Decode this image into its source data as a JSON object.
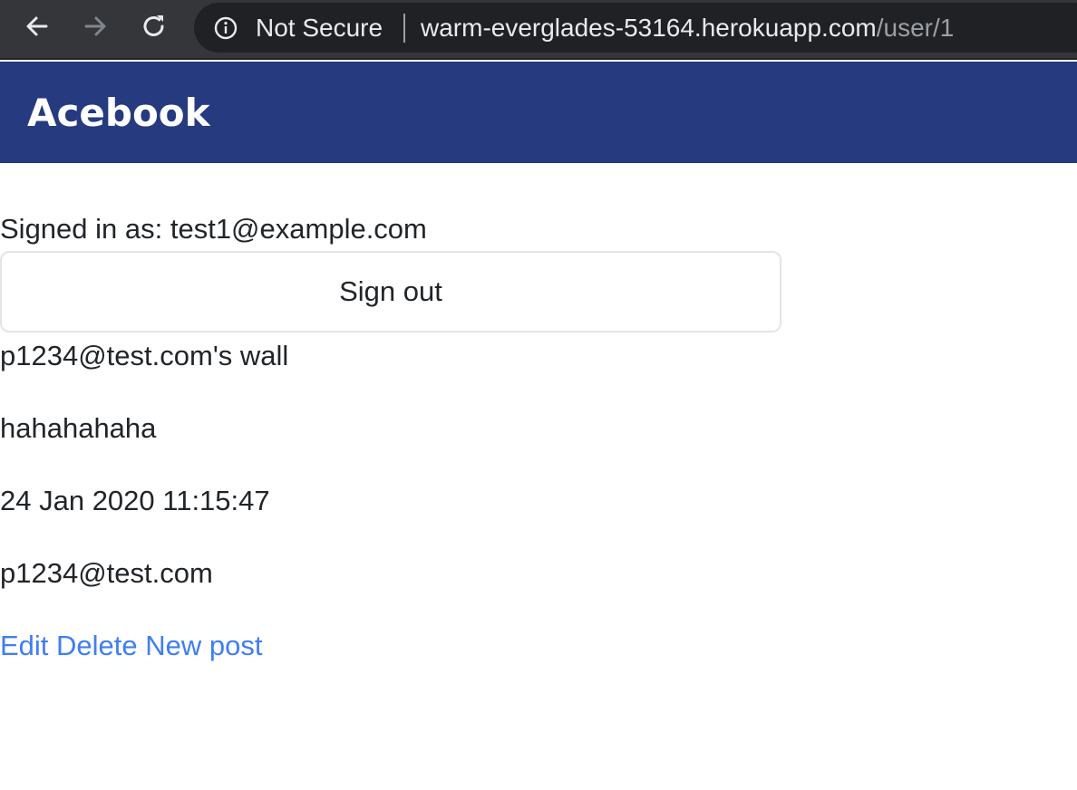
{
  "browser": {
    "security_label": "Not Secure",
    "url_host": "warm-everglades-53164.herokuapp.com",
    "url_path": "/user/1"
  },
  "header": {
    "site_title": "Acebook",
    "background_color": "#263a80"
  },
  "session": {
    "signed_in_text": "Signed in as: test1@example.com",
    "sign_out_label": "Sign out"
  },
  "wall": {
    "title": "p1234@test.com's wall",
    "post": {
      "body": "hahahahaha",
      "timestamp": "24 Jan 2020 11:15:47",
      "author": "p1234@test.com"
    }
  },
  "actions": {
    "edit_label": "Edit",
    "delete_label": "Delete",
    "new_post_label": "New post",
    "link_color": "#3f7ef5"
  },
  "icons": {
    "back": "arrow-left-icon",
    "forward": "arrow-right-icon",
    "reload": "reload-icon",
    "security": "info-icon"
  }
}
